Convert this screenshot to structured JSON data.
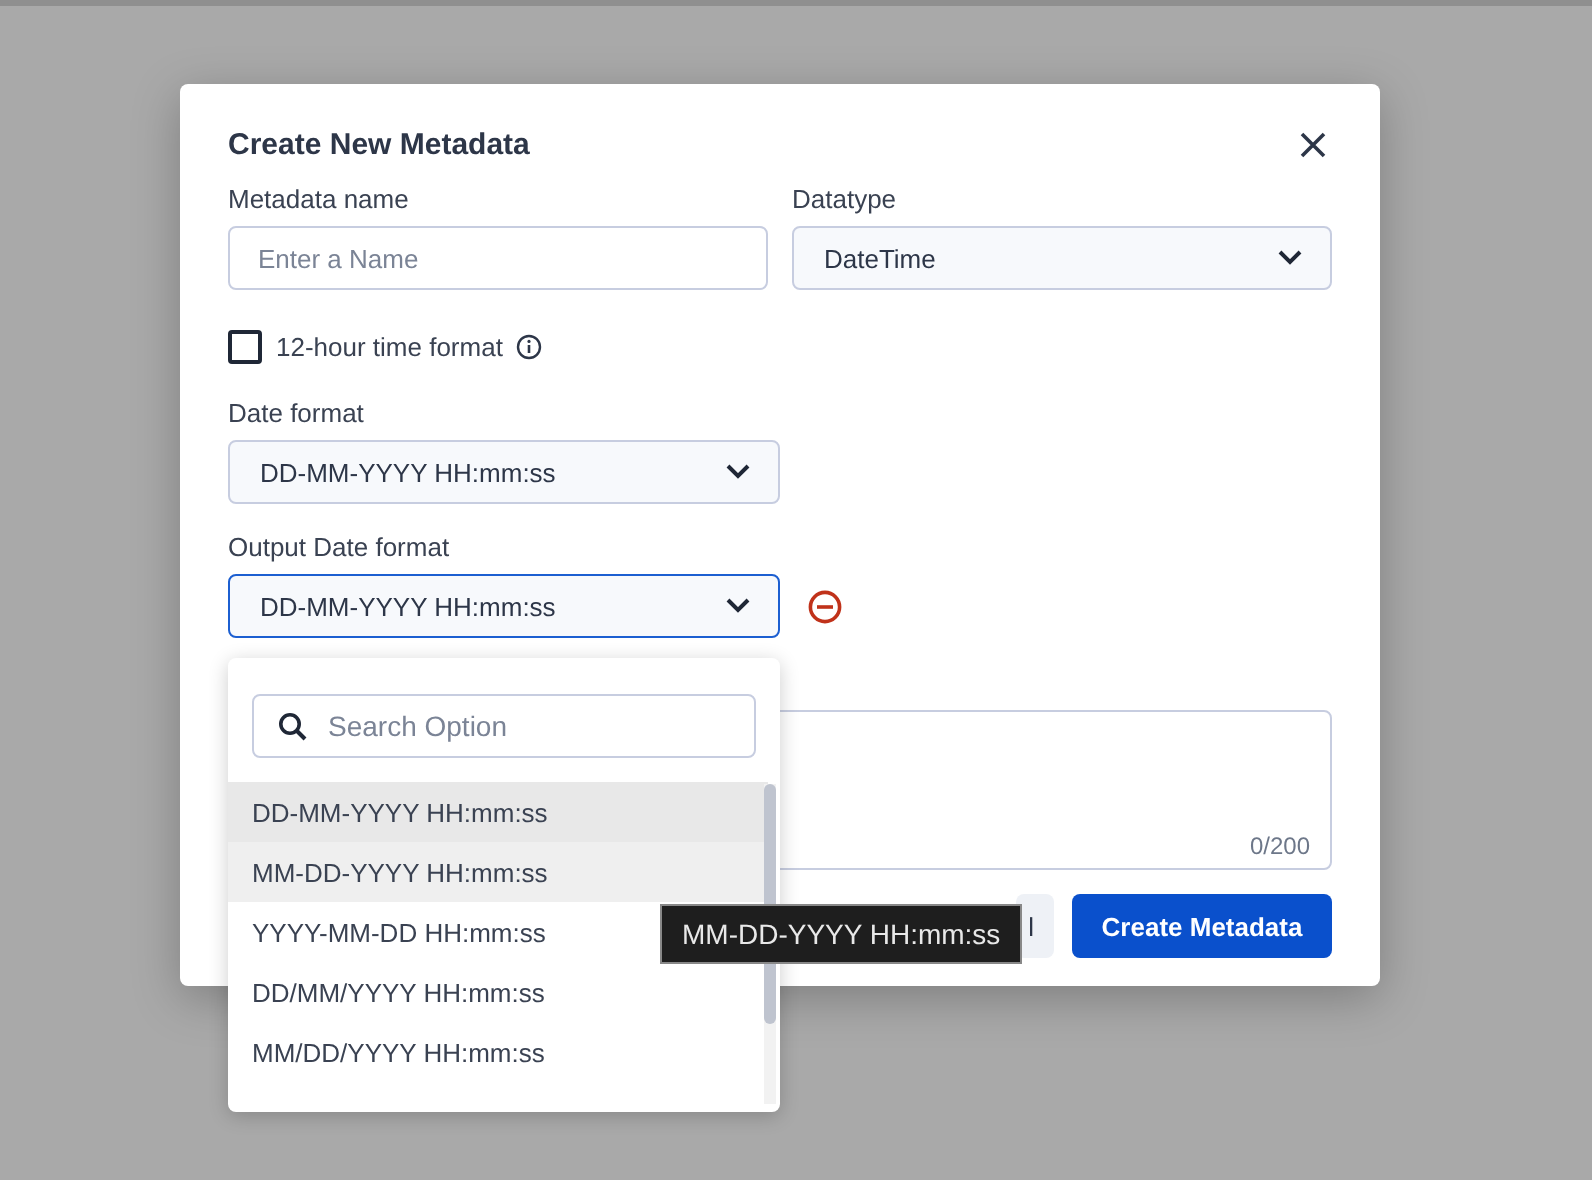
{
  "dialog": {
    "title": "Create New Metadata",
    "name_field": {
      "label": "Metadata name",
      "placeholder": "Enter a Name"
    },
    "datatype": {
      "label": "Datatype",
      "value": "DateTime"
    },
    "twelve_hour": {
      "label": "12-hour time format",
      "checked": false
    },
    "date_format": {
      "label": "Date format",
      "value": "DD-MM-YYYY HH:mm:ss"
    },
    "output_date_format": {
      "label": "Output Date format",
      "value": "DD-MM-YYYY HH:mm:ss",
      "focused": true
    },
    "description": {
      "counter": "0/200"
    },
    "buttons": [
      {
        "kind": "secondary",
        "label": "l"
      },
      {
        "kind": "primary",
        "label": "Create Metadata"
      }
    ]
  },
  "dropdown": {
    "search_placeholder": "Search Option",
    "options": [
      {
        "label": "DD-MM-YYYY HH:mm:ss",
        "selected": true,
        "hovered": false
      },
      {
        "label": "MM-DD-YYYY HH:mm:ss",
        "selected": false,
        "hovered": true
      },
      {
        "label": "YYYY-MM-DD HH:mm:ss",
        "selected": false,
        "hovered": false
      },
      {
        "label": "DD/MM/YYYY HH:mm:ss",
        "selected": false,
        "hovered": false
      },
      {
        "label": "MM/DD/YYYY HH:mm:ss",
        "selected": false,
        "hovered": false
      }
    ]
  },
  "tooltip": {
    "text": "MM-DD-YYYY HH:mm:ss"
  }
}
